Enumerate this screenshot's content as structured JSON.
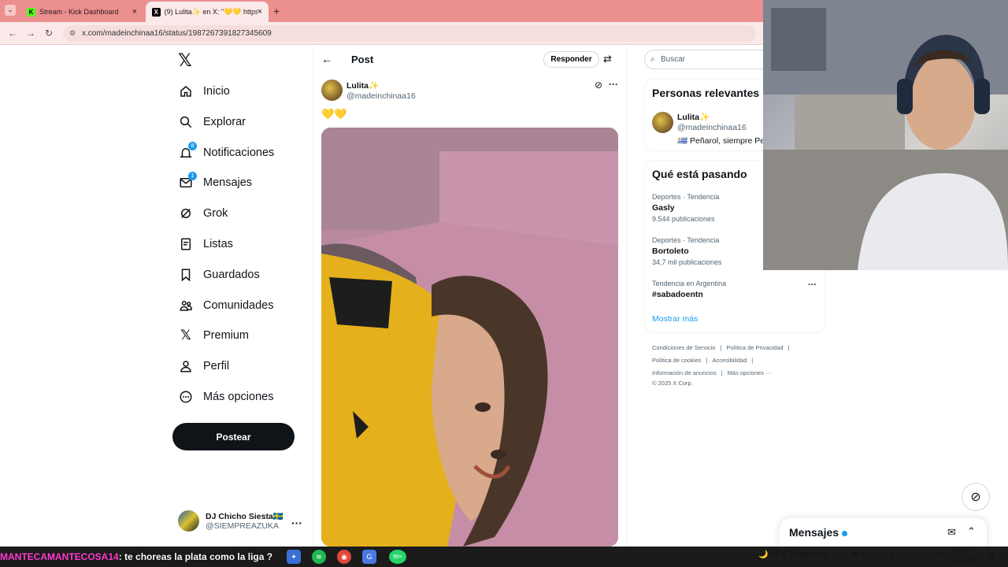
{
  "browser": {
    "tabs": [
      {
        "label": "Stream - Kick Dashboard",
        "favicon": "K"
      },
      {
        "label": "(9) Lulita✨ en X: \"💛💛 https:",
        "favicon": "X"
      }
    ],
    "url": "x.com/madeinchinaa16/status/1987267391827345609"
  },
  "sidebar": {
    "items": [
      {
        "label": "Inicio",
        "icon": "home-icon"
      },
      {
        "label": "Explorar",
        "icon": "search-icon"
      },
      {
        "label": "Notificaciones",
        "icon": "bell-icon",
        "badge": "8"
      },
      {
        "label": "Mensajes",
        "icon": "envelope-icon",
        "badge": "1"
      },
      {
        "label": "Grok",
        "icon": "grok-icon"
      },
      {
        "label": "Listas",
        "icon": "list-icon"
      },
      {
        "label": "Guardados",
        "icon": "bookmark-icon"
      },
      {
        "label": "Comunidades",
        "icon": "communities-icon"
      },
      {
        "label": "Premium",
        "icon": "x-logo-icon"
      },
      {
        "label": "Perfil",
        "icon": "person-icon"
      },
      {
        "label": "Más opciones",
        "icon": "more-circle-icon"
      }
    ],
    "post_button": "Postear",
    "account": {
      "name": "DJ Chicho Siesta🇸🇪",
      "handle": "@SIEMPREAZUKA"
    }
  },
  "post": {
    "header_title": "Post",
    "reply_button": "Responder",
    "author_name": "Lulita✨",
    "author_handle": "@madeinchinaa16",
    "text": "💛💛"
  },
  "right": {
    "search_placeholder": "Buscar",
    "relevant_title": "Personas relevantes",
    "relevant_person": {
      "name": "Lulita✨",
      "handle": "@madeinchinaa16",
      "bio": "🇺🇾 Peñarol, siempre Pe"
    },
    "trending_title": "Qué está pasando",
    "trends": [
      {
        "meta": "Deportes · Tendencia",
        "name": "Gasly",
        "count": "9.544 publicaciones"
      },
      {
        "meta": "Deportes · Tendencia",
        "name": "Bortoleto",
        "count": "34,7 mil publicaciones"
      },
      {
        "meta": "Tendencia en Argentina",
        "name": "#sabadoentn",
        "count": ""
      }
    ],
    "show_more": "Mostrar más",
    "footer": {
      "line1": [
        "Condiciones de Servicio",
        "|",
        "Política de Privacidad",
        "|"
      ],
      "line2": [
        "Política de cookies",
        "|",
        "Accesibilidad",
        "|"
      ],
      "line3": [
        "Información de anuncios",
        "|",
        "Más opciones ···"
      ],
      "line4": "© 2025 X Corp."
    }
  },
  "messages_dock": {
    "title": "Mensajes"
  },
  "taskbar": {
    "chat_user": "MANTECAMANTECOSA14",
    "chat_message": ": te choreas la plata como la liga ?",
    "whatsapp_badge": "99+",
    "weather": "18°C  Despejado",
    "lang": "ESP",
    "time": "20:17",
    "date": "8/11/2025"
  }
}
